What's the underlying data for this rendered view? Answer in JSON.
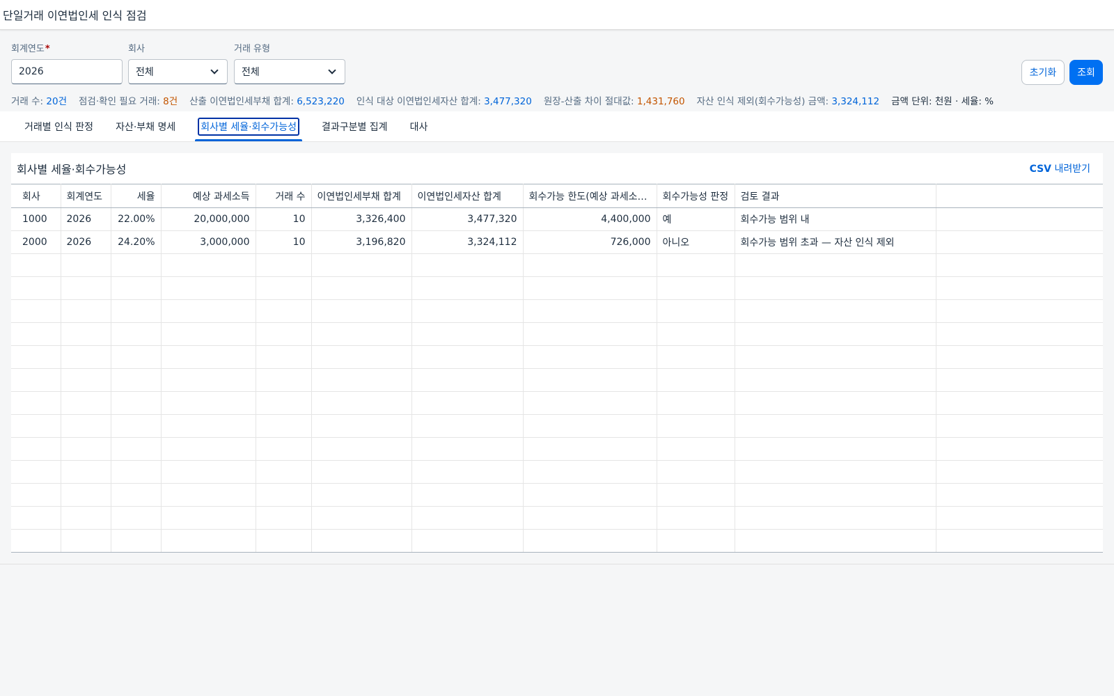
{
  "shell": {
    "title": "단일거래 이연법인세 인식 점검"
  },
  "filters": {
    "fiscal_year": {
      "label": "회계연도",
      "required": "*",
      "value": "2026"
    },
    "company": {
      "label": "회사",
      "value": "전체"
    },
    "txn_type": {
      "label": "거래 유형",
      "value": "전체"
    },
    "reset_label": "초기화",
    "search_label": "조회"
  },
  "summary": {
    "txn_count_label": "거래 수:",
    "txn_count": "20건",
    "check_needed_label": "점검·확인 필요 거래:",
    "check_needed": "8건",
    "calc_dtl_label": "산출 이연법인세부채 합계:",
    "calc_dtl": "6,523,220",
    "dta_label": "인식 대상 이연법인세자산 합계:",
    "dta": "3,477,320",
    "diff_label": "원장-산출 차이 절대값:",
    "diff": "1,431,760",
    "excluded_label": "자산 인식 제외(회수가능성) 금액:",
    "excluded": "3,324,112",
    "unit": "금액 단위: 천원 · 세율: %"
  },
  "tabs": [
    {
      "label": "거래별 인식 판정"
    },
    {
      "label": "자산·부채 명세"
    },
    {
      "label": "회사별 세율·회수가능성"
    },
    {
      "label": "결과구분별 집계"
    },
    {
      "label": "대사"
    }
  ],
  "panel": {
    "title": "회사별 세율·회수가능성",
    "csv_bold": "CSV",
    "csv_rest": " 내려받기"
  },
  "table": {
    "headers": [
      "회사",
      "회계연도",
      "세율",
      "예상 과세소득",
      "거래 수",
      "이연법인세부채 합계",
      "이연법인세자산 합계",
      "회수가능 한도(예상 과세소득 × 세율)",
      "회수가능성 판정",
      "검토 결과"
    ],
    "rows": [
      [
        "1000",
        "2026",
        "22.00%",
        "20,000,000",
        "10",
        "3,326,400",
        "3,477,320",
        "4,400,000",
        "예",
        "회수가능 범위 내"
      ],
      [
        "2000",
        "2026",
        "24.20%",
        "3,000,000",
        "10",
        "3,196,820",
        "3,324,112",
        "726,000",
        "아니오",
        "회수가능 범위 초과 — 자산 인식 제외"
      ]
    ]
  }
}
